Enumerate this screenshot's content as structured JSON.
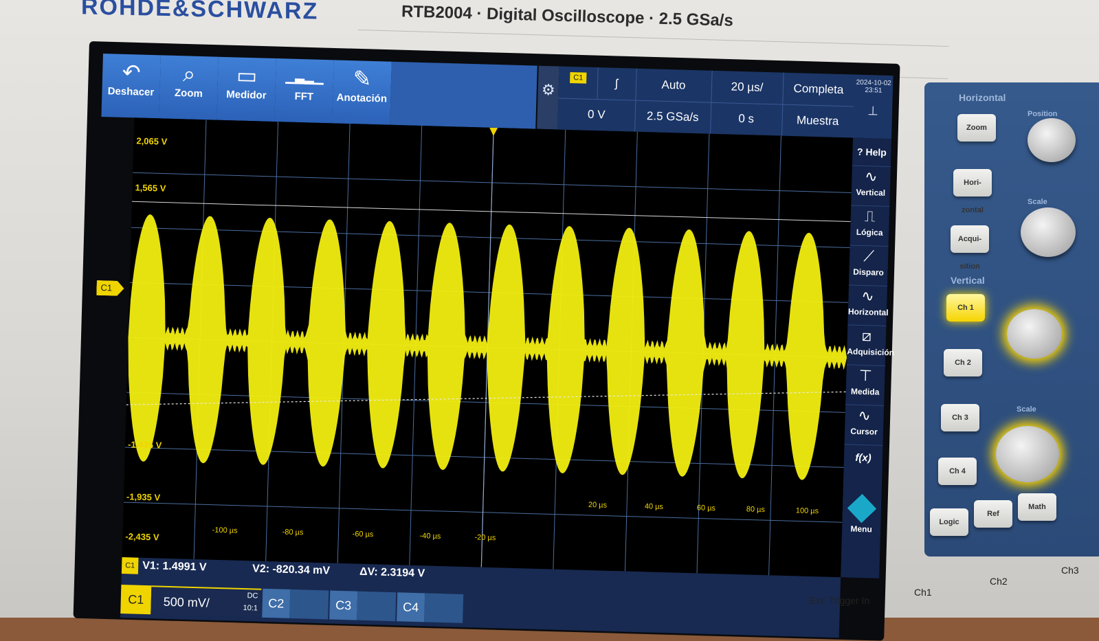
{
  "bezel": {
    "brand": "ROHDE&SCHWARZ",
    "model_line": "RTB2004 · Digital Oscilloscope · 2.5 GSa/s"
  },
  "toolbar": [
    {
      "label": "Deshacer",
      "icon": "undo-icon",
      "glyph": "↶"
    },
    {
      "label": "Zoom",
      "icon": "zoom-icon",
      "glyph": "⌕"
    },
    {
      "label": "Medidor",
      "icon": "meter-icon",
      "glyph": "▭"
    },
    {
      "label": "FFT",
      "icon": "fft-icon",
      "glyph": "▁▃▂▁"
    },
    {
      "label": "Anotación",
      "icon": "pencil-icon",
      "glyph": "✎"
    }
  ],
  "status": {
    "channel": "C1",
    "edge": "ʃ",
    "trigger_mode": "Auto",
    "time_scale": "20 µs/",
    "acq_mode": "Completa",
    "trigger_level": "0 V",
    "sample_rate": "2.5 GSa/s",
    "time_offset": "0 s",
    "sample_mode": "Muestra",
    "date": "2024-10-02",
    "time": "23:51"
  },
  "sidebar": [
    {
      "label": "Help",
      "icon": "help-icon",
      "glyph": "?"
    },
    {
      "label": "Vertical",
      "icon": "vertical-icon",
      "glyph": "∿"
    },
    {
      "label": "Lógica",
      "icon": "logic-icon",
      "glyph": "⎍"
    },
    {
      "label": "Disparo",
      "icon": "trigger-icon",
      "glyph": "⟋"
    },
    {
      "label": "Horizontal",
      "icon": "horizontal-icon",
      "glyph": "∿"
    },
    {
      "label": "Adquisición",
      "icon": "acquisition-icon",
      "glyph": "⧄"
    },
    {
      "label": "Medida",
      "icon": "measure-icon",
      "glyph": "⊤"
    },
    {
      "label": "Cursor",
      "icon": "cursor-icon",
      "glyph": "∿"
    },
    {
      "label": "f(x)",
      "icon": "math-icon",
      "glyph": ""
    }
  ],
  "menu_label": "Menu",
  "plot": {
    "y_labels": [
      "2,065 V",
      "1,565 V",
      "-1,435 V",
      "-1,935 V",
      "-2,435 V"
    ],
    "x_labels": [
      "-100 µs",
      "-80 µs",
      "-60 µs",
      "-40 µs",
      "-20 µs",
      "20 µs",
      "40 µs",
      "60 µs",
      "80 µs",
      "100 µs"
    ],
    "channel_marker": "C1",
    "trace_color": "#f2ee10",
    "burst_count": 12
  },
  "measurements": {
    "v1": "V1: 1.4991 V",
    "v2": "V2: -820.34 mV",
    "dv": "ΔV: 2.3194 V"
  },
  "channels": {
    "c1_label": "C1",
    "c1_scale": "500 mV/",
    "c1_coupling": "DC",
    "c1_probe": "10:1",
    "c2": "C2",
    "c3": "C3",
    "c4": "C4"
  },
  "panel": {
    "horizontal_title": "Horizontal",
    "vertical_title": "Vertical",
    "position_label": "Position",
    "scale_label": "Scale",
    "buttons": [
      "Zoom",
      "Hori-zontal",
      "Acqui-sition",
      "Ch 1",
      "Ch 2",
      "Ch 3",
      "Ch 4",
      "Logic",
      "Ref",
      "Math"
    ],
    "jacks": [
      "Ext. Trigger In",
      "Ch1",
      "Ch2",
      "Ch3"
    ]
  }
}
